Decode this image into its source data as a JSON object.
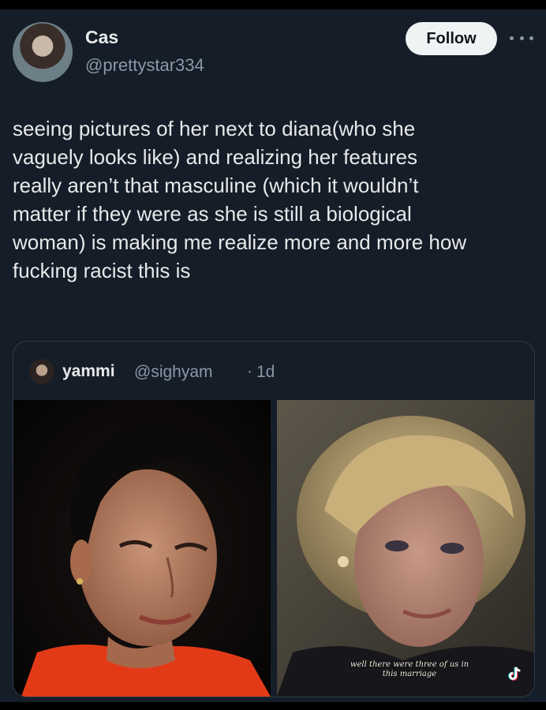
{
  "post": {
    "author": {
      "name": "Cas",
      "handle": "@prettystar334"
    },
    "follow_label": "Follow",
    "more_icon": "more-horizontal-icon",
    "text_lines": [
      "seeing pictures of her next to diana(who she",
      "vaguely looks like) and realizing her features",
      "really aren’t that masculine (which it wouldn’t",
      "matter if they were as she is still a biological",
      "woman) is making me realize more and more how",
      "fucking racist this is"
    ]
  },
  "quoted_post": {
    "name": "yammi",
    "handle": "@sighyam",
    "separator": "·",
    "time": "1d",
    "media": [
      {
        "subject": "woman-short-dark-hair-red-top"
      },
      {
        "subject": "woman-blonde-hair-interview",
        "caption_lines": [
          "well there were three of us in",
          "this marriage"
        ],
        "watermark_icon": "tiktok-icon"
      }
    ]
  },
  "colors": {
    "background": "#151d28",
    "text_primary": "#e7e9ea",
    "text_secondary": "#8b98a5",
    "follow_bg": "#eff3f4",
    "border": "#2f3a46"
  }
}
